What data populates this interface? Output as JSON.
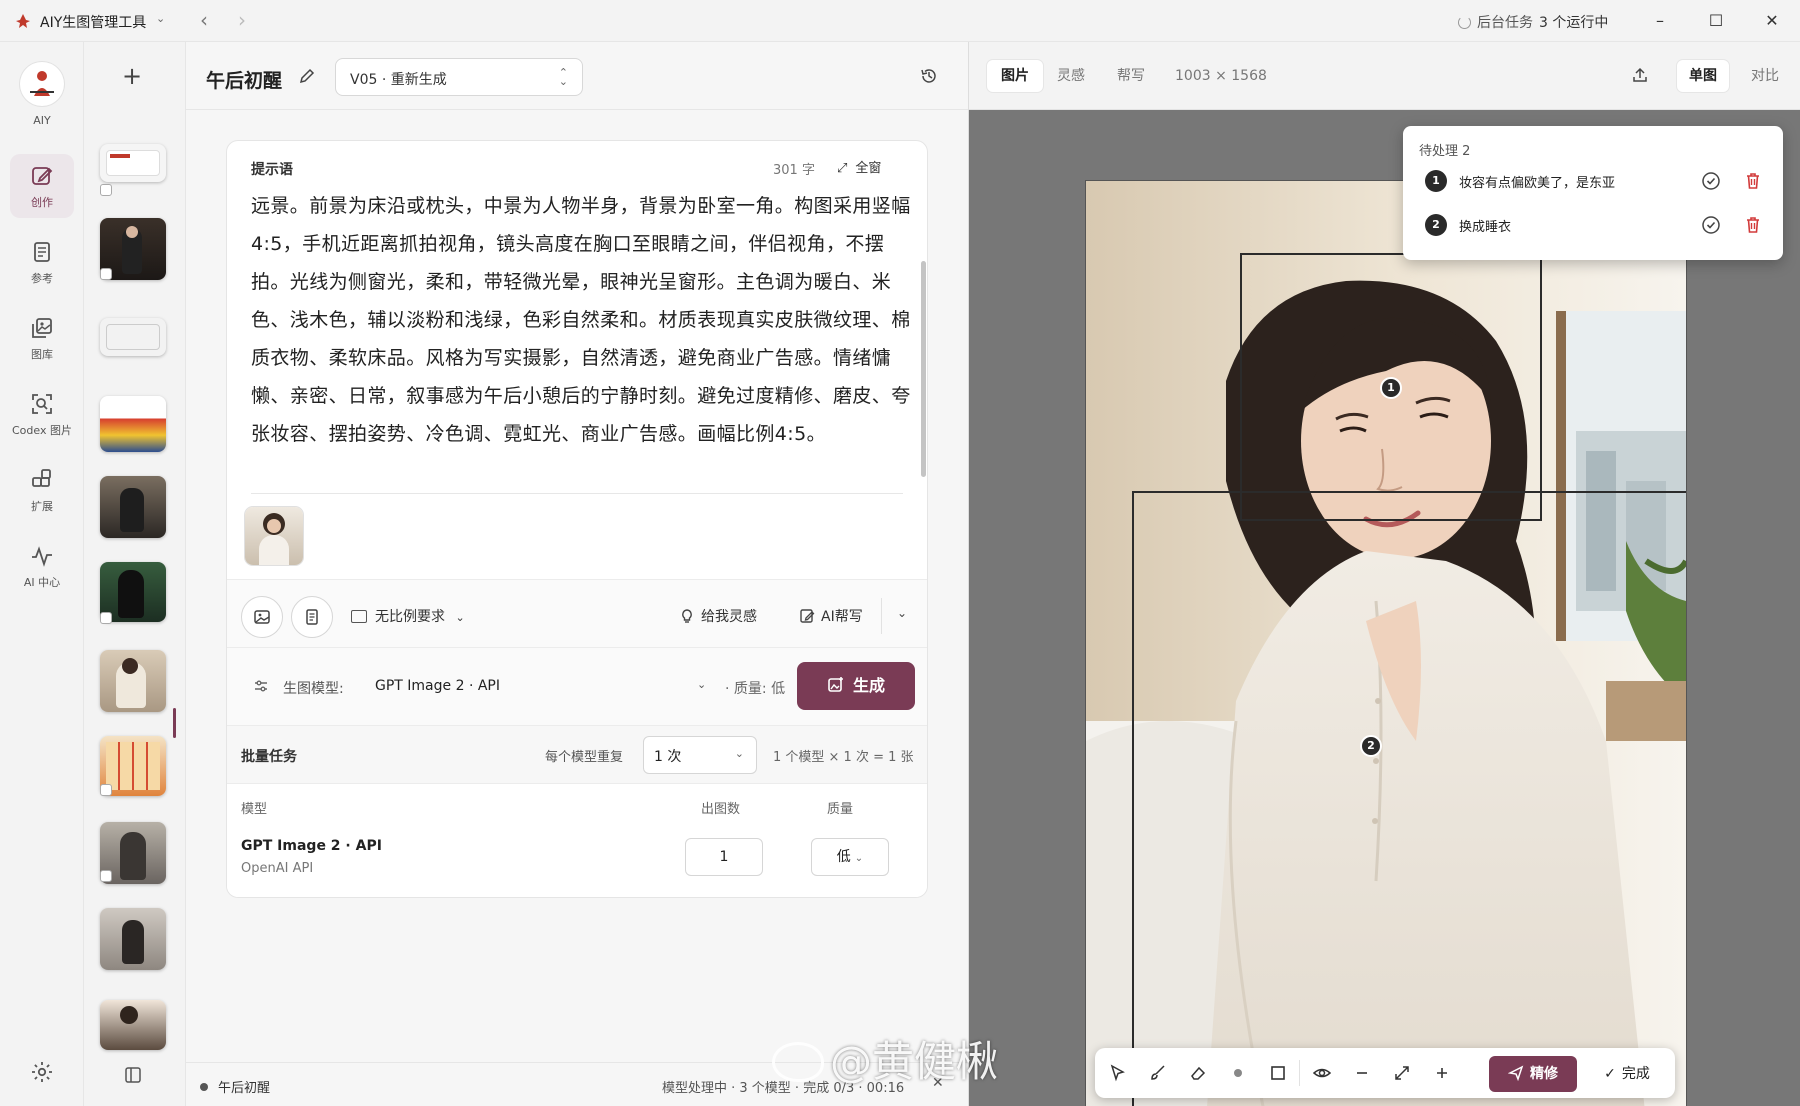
{
  "titlebar": {
    "app_name": "AIY生图管理工具",
    "background_tasks_label": "后台任务",
    "running_count": "3 个运行中"
  },
  "rail": {
    "logo_label": "AIY",
    "items": [
      {
        "label": "创作",
        "icon": "edit-icon",
        "active": true
      },
      {
        "label": "参考",
        "icon": "book-icon",
        "active": false
      },
      {
        "label": "图库",
        "icon": "gallery-icon",
        "active": false
      },
      {
        "label": "Codex 图片",
        "icon": "image-scan-icon",
        "active": false
      },
      {
        "label": "扩展",
        "icon": "extension-icon",
        "active": false
      },
      {
        "label": "AI 中心",
        "icon": "pulse-icon",
        "active": false
      }
    ]
  },
  "editor": {
    "title": "午后初醒",
    "version": "V05 · 重新生成"
  },
  "prompt": {
    "label": "提示语",
    "char_count": "301 字",
    "fullscreen_label": "全窗",
    "text": "远景。前景为床沿或枕头，中景为人物半身，背景为卧室一角。构图采用竖幅4:5，手机近距离抓拍视角，镜头高度在胸口至眼睛之间，伴侣视角，不摆拍。光线为侧窗光，柔和，带轻微光晕，眼神光呈窗形。主色调为暖白、米色、浅木色，辅以淡粉和浅绿，色彩自然柔和。材质表现真实皮肤微纹理、棉质衣物、柔软床品。风格为写实摄影，自然清透，避免商业广告感。情绪慵懒、亲密、日常，叙事感为午后小憩后的宁静时刻。避免过度精修、磨皮、夸张妆容、摆拍姿势、冷色调、霓虹光、商业广告感。画幅比例4:5。"
  },
  "toolbar": {
    "ratio_label": "无比例要求",
    "inspire_label": "给我灵感",
    "ai_write_label": "AI帮写"
  },
  "model": {
    "label": "生图模型:",
    "value": "GPT Image 2 · API",
    "quality": "· 质量: 低",
    "generate_label": "生成"
  },
  "batch": {
    "title": "批量任务",
    "repeat_label": "每个模型重复",
    "repeat_value": "1 次",
    "formula": "1 个模型 × 1 次 = 1 张",
    "col_model": "模型",
    "col_count": "出图数",
    "col_quality": "质量",
    "rows": [
      {
        "model": "GPT Image 2 · API",
        "provider": "OpenAI API",
        "count": "1",
        "quality": "低"
      }
    ]
  },
  "status": {
    "doc": "午后初醒",
    "progress": "模型处理中 · 3 个模型 · 完成 0/3 · 00:16"
  },
  "preview": {
    "tabs": [
      "图片",
      "灵感",
      "帮写"
    ],
    "active_tab": "图片",
    "dimensions": "1003 × 1568",
    "view_single": "单图",
    "view_compare": "对比",
    "pending_title": "待处理 2",
    "pending": [
      {
        "num": "1",
        "text": "妆容有点偏欧美了，是东亚"
      },
      {
        "num": "2",
        "text": "换成睡衣"
      }
    ],
    "refine_label": "精修",
    "done_label": "完成"
  },
  "watermark": "@黄健楸",
  "colors": {
    "accent": "#7a3b55",
    "canvas_bg": "#777777",
    "delete_red": "#d23b3b"
  }
}
